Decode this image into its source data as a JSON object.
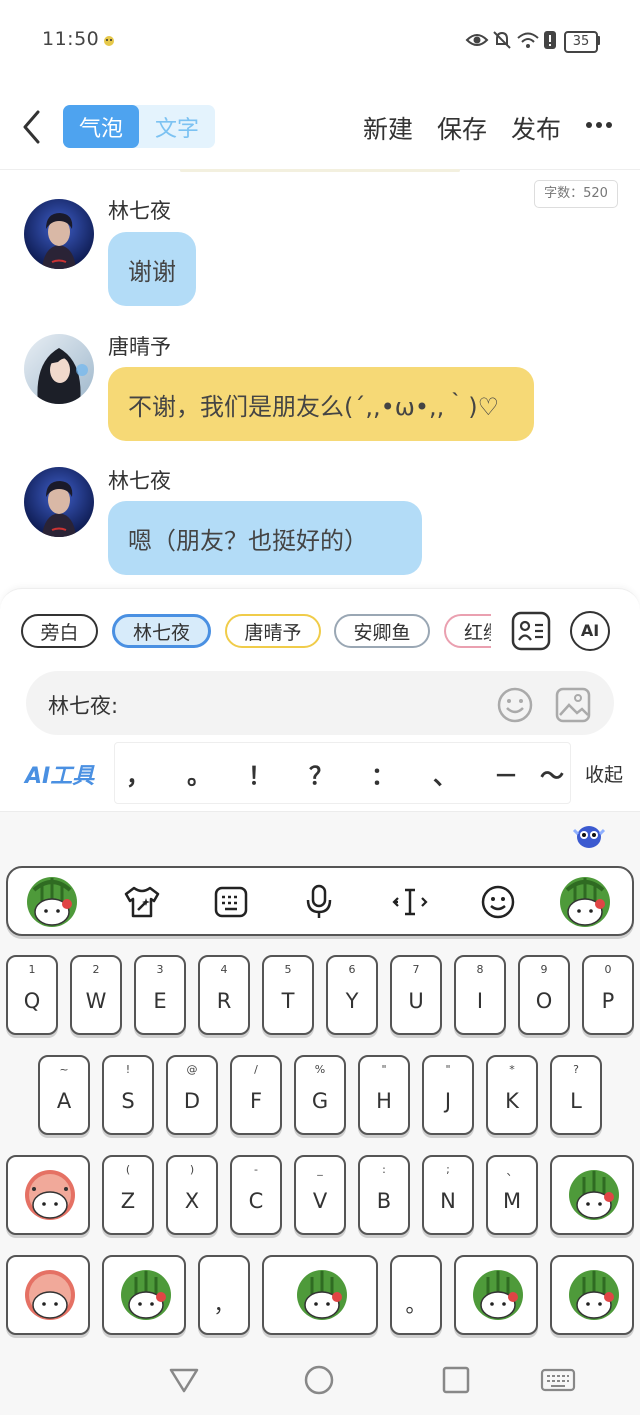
{
  "status_bar": {
    "time": "11:50",
    "battery": "35"
  },
  "header": {
    "tabs": [
      {
        "label": "气泡"
      },
      {
        "label": "文字"
      }
    ],
    "actions": {
      "new": "新建",
      "save": "保存",
      "publish": "发布"
    }
  },
  "word_count": "字数：520",
  "messages": [
    {
      "name": "林七夜",
      "text": "谢谢"
    },
    {
      "name": "唐晴予",
      "text": "不谢，我们是朋友么(´,,•ω•,,｀)♡"
    },
    {
      "name": "林七夜",
      "text": "嗯（朋友？也挺好的）"
    }
  ],
  "roles": [
    "旁白",
    "林七夜",
    "唐晴予",
    "安卿鱼",
    "红缨"
  ],
  "composer": {
    "value": "林七夜:"
  },
  "toolbar": {
    "ai_tools": "AI工具",
    "ai_label": "AI",
    "punctuation": [
      "，",
      "。",
      "！",
      "？",
      "：",
      "、",
      "－",
      "～"
    ],
    "collapse": "收起"
  },
  "keyboard": {
    "row1": [
      {
        "k": "Q",
        "s": "1"
      },
      {
        "k": "W",
        "s": "2"
      },
      {
        "k": "E",
        "s": "3"
      },
      {
        "k": "R",
        "s": "4"
      },
      {
        "k": "T",
        "s": "5"
      },
      {
        "k": "Y",
        "s": "6"
      },
      {
        "k": "U",
        "s": "7"
      },
      {
        "k": "I",
        "s": "8"
      },
      {
        "k": "O",
        "s": "9"
      },
      {
        "k": "P",
        "s": "0"
      }
    ],
    "row2": [
      {
        "k": "A",
        "s": "~"
      },
      {
        "k": "S",
        "s": "!"
      },
      {
        "k": "D",
        "s": "@"
      },
      {
        "k": "F",
        "s": "/"
      },
      {
        "k": "G",
        "s": "%"
      },
      {
        "k": "H",
        "s": "\""
      },
      {
        "k": "J",
        "s": "\""
      },
      {
        "k": "K",
        "s": "*"
      },
      {
        "k": "L",
        "s": "?"
      }
    ],
    "row3": [
      {
        "k": "Z",
        "s": "("
      },
      {
        "k": "X",
        "s": ")"
      },
      {
        "k": "C",
        "s": "-"
      },
      {
        "k": "V",
        "s": "_"
      },
      {
        "k": "B",
        "s": ":"
      },
      {
        "k": "N",
        "s": ";"
      },
      {
        "k": "M",
        "s": "、"
      }
    ],
    "comma": "，",
    "period": "。"
  },
  "colors": {
    "accent": "#4a90e2",
    "bubble_blue": "#b3dcf7",
    "bubble_yellow": "#f6d976"
  }
}
